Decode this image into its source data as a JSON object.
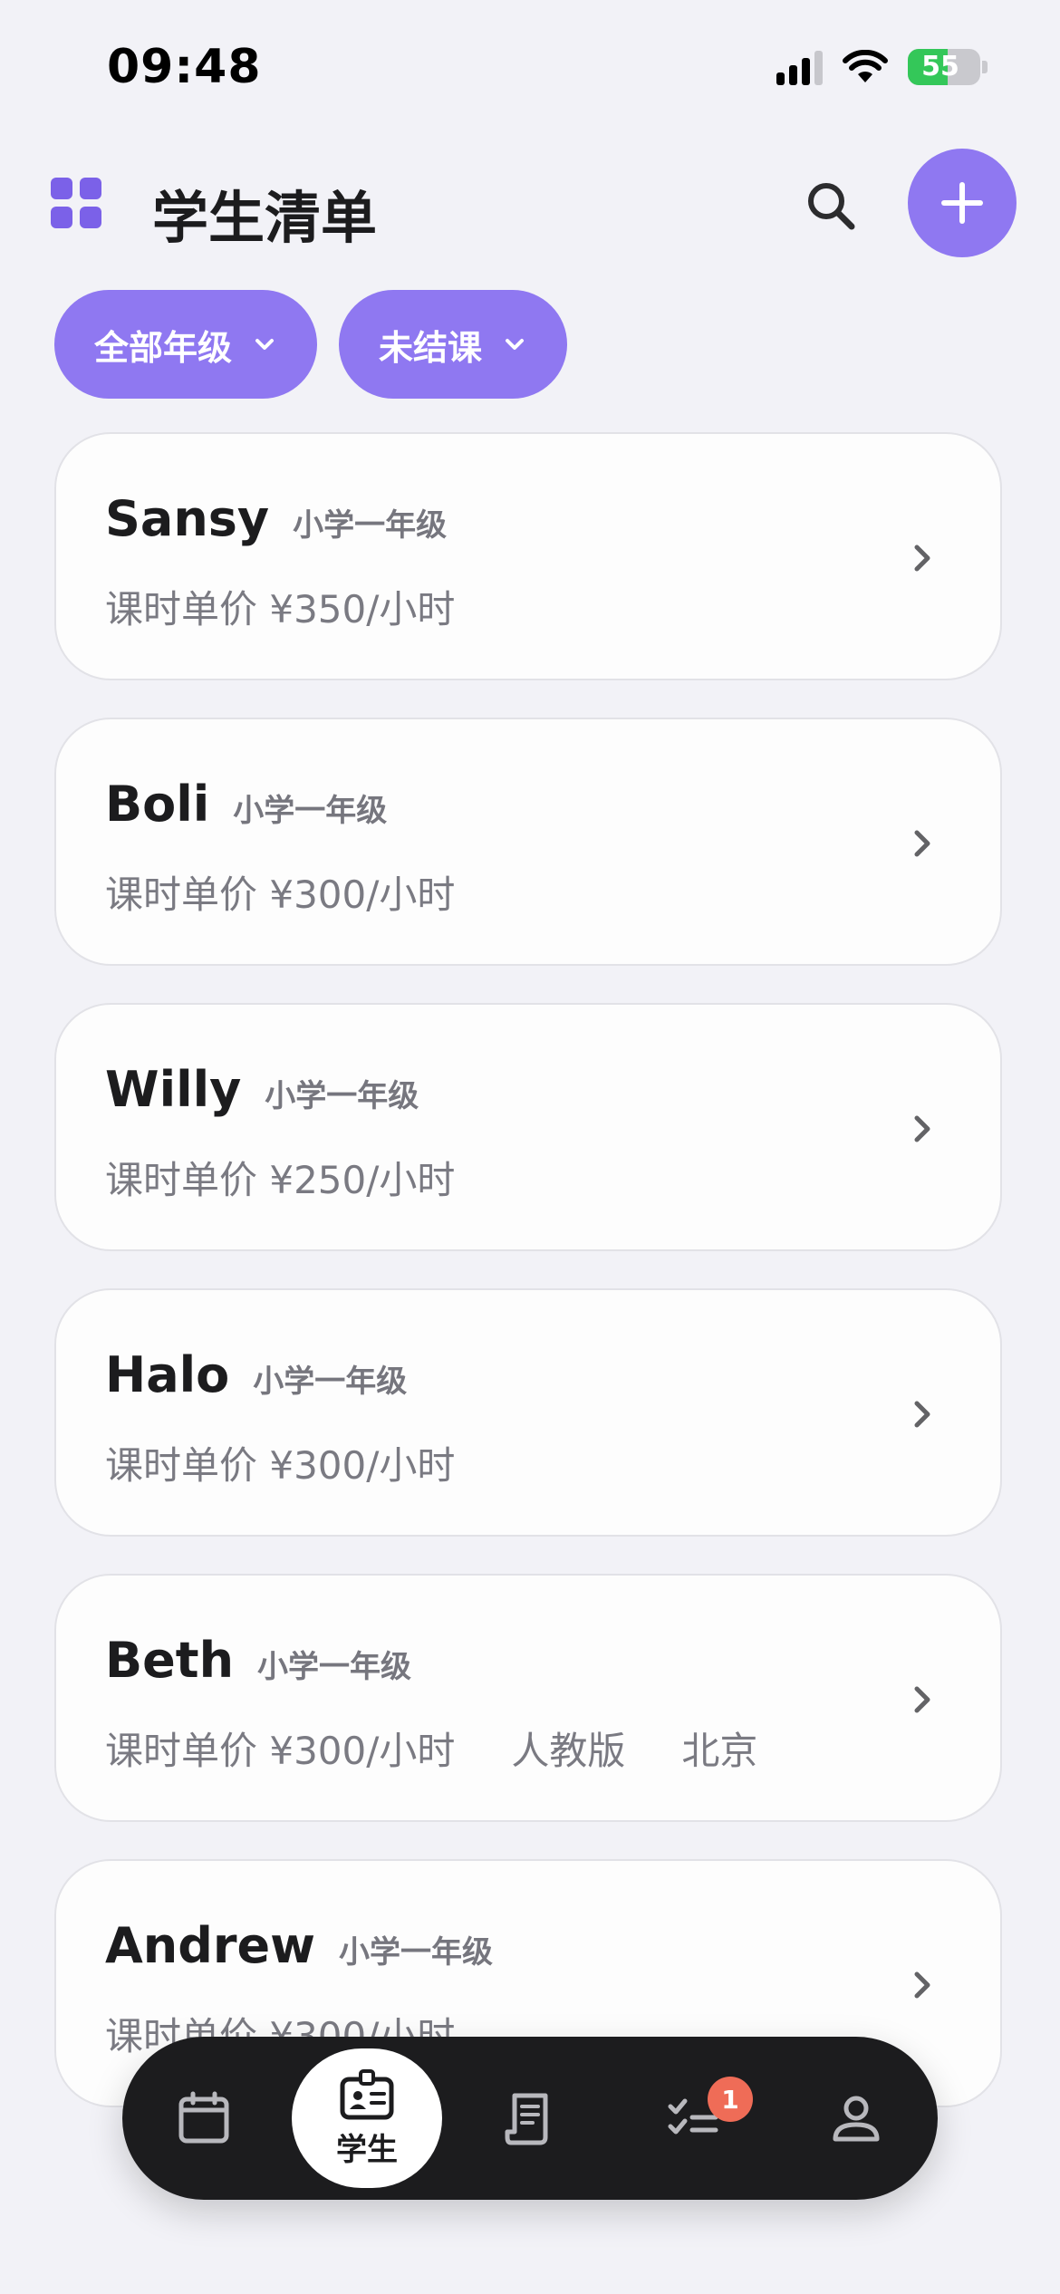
{
  "status_bar": {
    "time": "09:48",
    "battery": "55",
    "battery_fraction": 0.55
  },
  "header": {
    "title": "学生清单",
    "menu_icon": "grid-icon",
    "search_icon": "search-icon",
    "add_icon": "plus-icon"
  },
  "filters": [
    {
      "label": "全部年级",
      "icon": "chevron-down-icon"
    },
    {
      "label": "未结课",
      "icon": "chevron-down-icon"
    }
  ],
  "students": [
    {
      "name": "Sansy",
      "grade": "小学一年级",
      "price": "课时单价 ¥350/小时",
      "extra": []
    },
    {
      "name": "Boli",
      "grade": "小学一年级",
      "price": "课时单价 ¥300/小时",
      "extra": []
    },
    {
      "name": "Willy",
      "grade": "小学一年级",
      "price": "课时单价 ¥250/小时",
      "extra": []
    },
    {
      "name": "Halo",
      "grade": "小学一年级",
      "price": "课时单价 ¥300/小时",
      "extra": []
    },
    {
      "name": "Beth",
      "grade": "小学一年级",
      "price": "课时单价 ¥300/小时",
      "extra": [
        "人教版",
        "北京"
      ]
    },
    {
      "name": "Andrew",
      "grade": "小学一年级",
      "price": "课时单价 ¥300/小时",
      "extra": []
    }
  ],
  "tab_bar": {
    "tabs": [
      {
        "icon": "calendar-icon"
      },
      {
        "icon": "student-id-icon",
        "label": "学生",
        "active": true
      },
      {
        "icon": "receipt-icon"
      },
      {
        "icon": "checklist-icon",
        "badge": "1"
      },
      {
        "icon": "profile-icon"
      }
    ]
  },
  "colors": {
    "accent": "#8f78f1",
    "accent_dark": "#7b61e8",
    "background": "#f2f2f7",
    "tab_bar": "#1c1c1e",
    "badge": "#ef6c57"
  }
}
